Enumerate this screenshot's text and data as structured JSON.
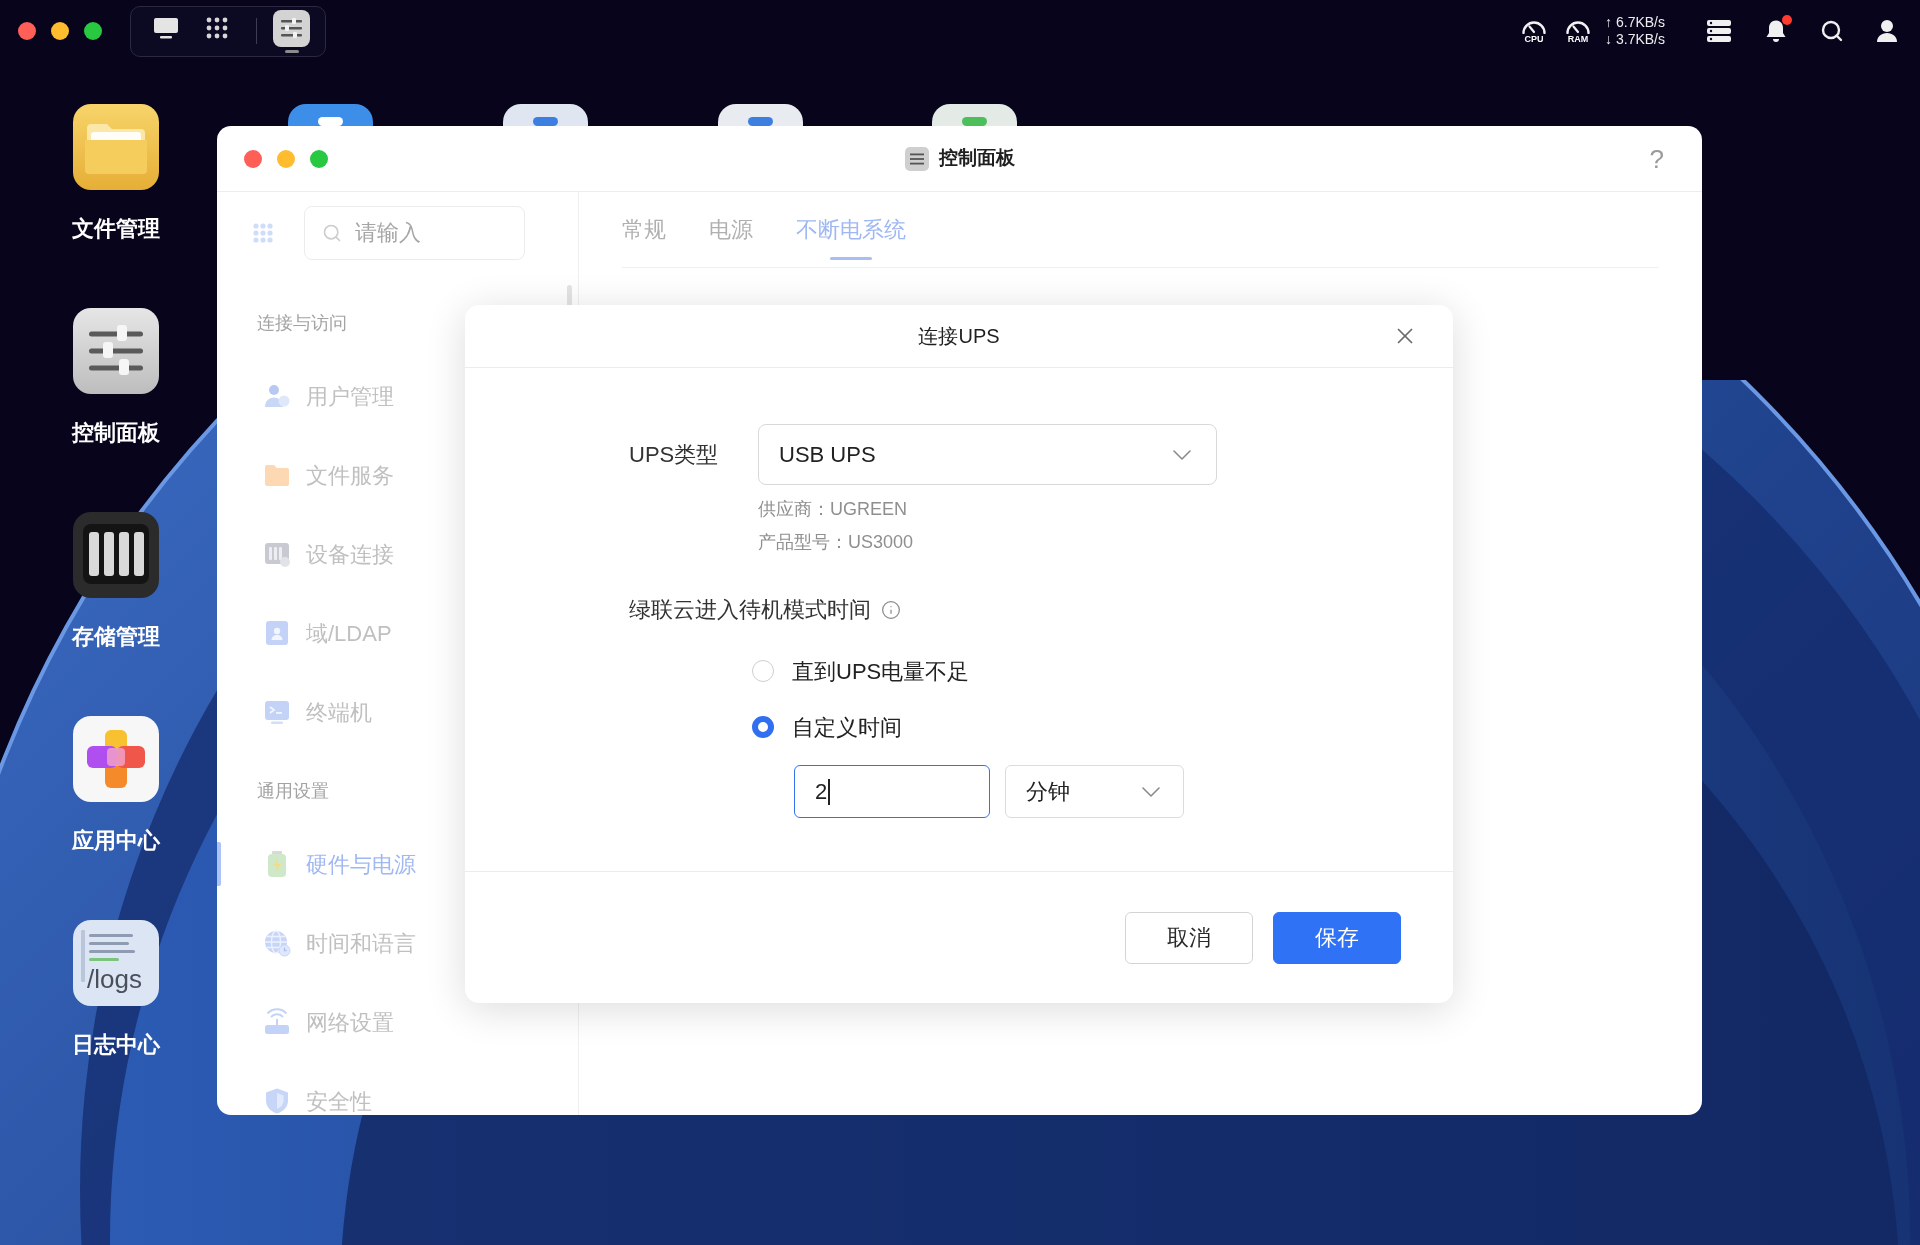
{
  "taskbar": {
    "pinned": [
      {
        "kind": "desktop",
        "selected": false
      },
      {
        "kind": "launcher",
        "selected": false
      }
    ],
    "running": [
      {
        "kind": "control-panel",
        "selected": true
      }
    ]
  },
  "status": {
    "cpu_label": "CPU",
    "ram_label": "RAM",
    "upload": "↑ 6.7KB/s",
    "download": "↓ 3.7KB/s",
    "notifications_unread": true
  },
  "desktop_icons": [
    {
      "kind": "folder",
      "label": "文件管理"
    },
    {
      "kind": "control-panel",
      "label": "控制面板"
    },
    {
      "kind": "storage",
      "label": "存储管理"
    },
    {
      "kind": "app-center",
      "label": "应用中心"
    },
    {
      "kind": "logs",
      "label": "日志中心",
      "icon_text": "/logs"
    }
  ],
  "hidden_icons": [
    {
      "color": "#3d8ee8"
    },
    {
      "color": "#dfe6f2"
    },
    {
      "color": "#e8ebef"
    },
    {
      "color": "#e4ebe6"
    }
  ],
  "window": {
    "title": "控制面板",
    "help": "?"
  },
  "sidebar": {
    "search": {
      "placeholder": "请输入"
    },
    "sections": [
      {
        "heading": "连接与访问",
        "items": [
          {
            "kind": "users",
            "label": "用户管理",
            "selected": false
          },
          {
            "kind": "folder",
            "label": "文件服务",
            "selected": false
          },
          {
            "kind": "device",
            "label": "设备连接",
            "selected": false
          },
          {
            "kind": "domain",
            "label": "域/LDAP",
            "selected": false
          },
          {
            "kind": "terminal",
            "label": "终端机",
            "selected": false
          }
        ]
      },
      {
        "heading": "通用设置",
        "items": [
          {
            "kind": "hardware",
            "label": "硬件与电源",
            "selected": true
          },
          {
            "kind": "time",
            "label": "时间和语言",
            "selected": false
          },
          {
            "kind": "network",
            "label": "网络设置",
            "selected": false
          },
          {
            "kind": "security",
            "label": "安全性",
            "selected": false
          }
        ]
      }
    ]
  },
  "tabs": [
    {
      "label": "常规",
      "selected": false
    },
    {
      "label": "电源",
      "selected": false
    },
    {
      "label": "不断电系统",
      "selected": true
    }
  ],
  "dialog": {
    "title": "连接UPS",
    "ups_type": {
      "label": "UPS类型",
      "value": "USB UPS"
    },
    "vendor": "供应商：UGREEN",
    "model": "产品型号：US3000",
    "standby": {
      "label": "绿联云进入待机模式时间",
      "options": [
        {
          "label": "直到UPS电量不足",
          "selected": false
        },
        {
          "label": "自定义时间",
          "selected": true
        }
      ],
      "time_field": {
        "value": "2",
        "focused": true
      },
      "unit": "分钟"
    },
    "buttons": [
      {
        "kind": "secondary",
        "label": "取消"
      },
      {
        "kind": "primary",
        "label": "保存"
      }
    ]
  }
}
